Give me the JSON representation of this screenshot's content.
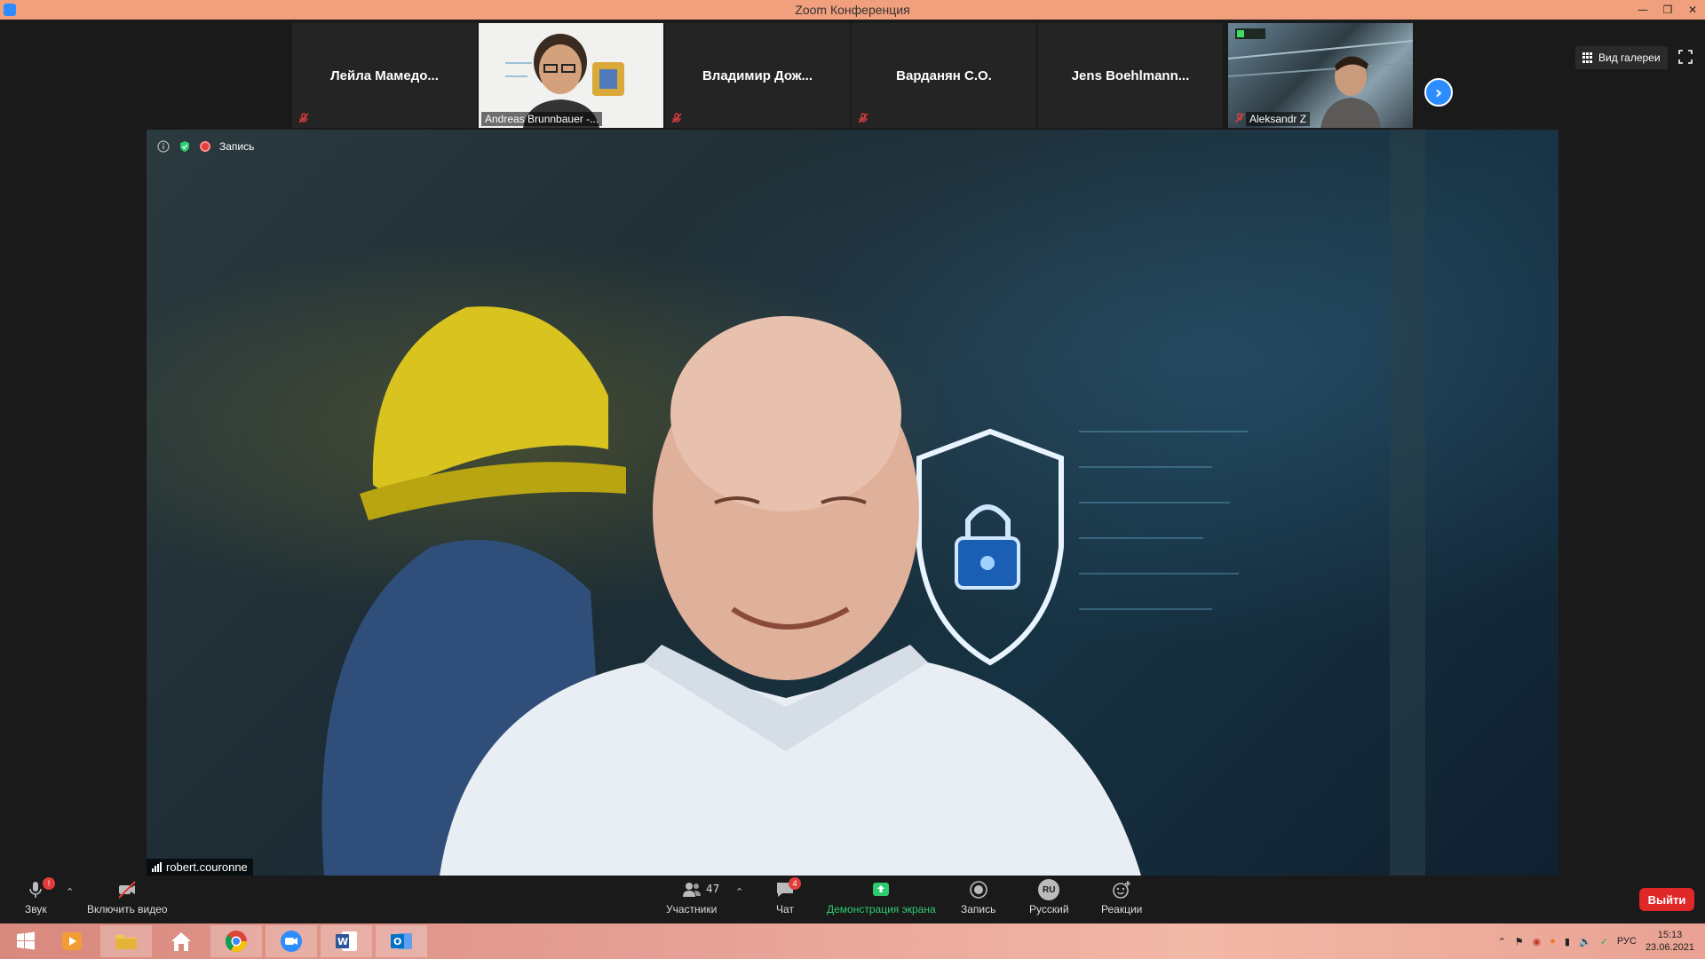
{
  "window": {
    "title": "Zoom Конференция"
  },
  "gallery": {
    "view_label": "Вид галереи",
    "participants": [
      {
        "name": "Лейла  Мамедо...",
        "video": false,
        "muted": true
      },
      {
        "name": "Andreas Brunnbauer -...",
        "video": true,
        "muted": false
      },
      {
        "name": "Владимир  Дож...",
        "video": false,
        "muted": true
      },
      {
        "name": "Варданян С.О.",
        "video": false,
        "muted": true
      },
      {
        "name": "Jens  Boehlmann...",
        "video": false,
        "muted": false
      },
      {
        "name": "Aleksandr Z",
        "video": true,
        "muted": true
      }
    ]
  },
  "main_video": {
    "recording_label": "Запись",
    "speaker": "robert.couronne"
  },
  "toolbar": {
    "audio_label": "Звук",
    "video_label": "Включить видео",
    "participants_label": "Участники",
    "participants_count": "47",
    "chat_label": "Чат",
    "chat_badge": "4",
    "share_label": "Демонстрация экрана",
    "record_label": "Запись",
    "language_label": "Русский",
    "language_code": "RU",
    "reactions_label": "Реакции",
    "leave_label": "Выйти"
  },
  "taskbar": {
    "language": "РУС",
    "time": "15:13",
    "date": "23.06.2021"
  },
  "colors": {
    "accent": "#2d8cff",
    "share_green": "#2ecc71",
    "leave_red": "#e02828",
    "titlebar": "#f0a07c"
  }
}
